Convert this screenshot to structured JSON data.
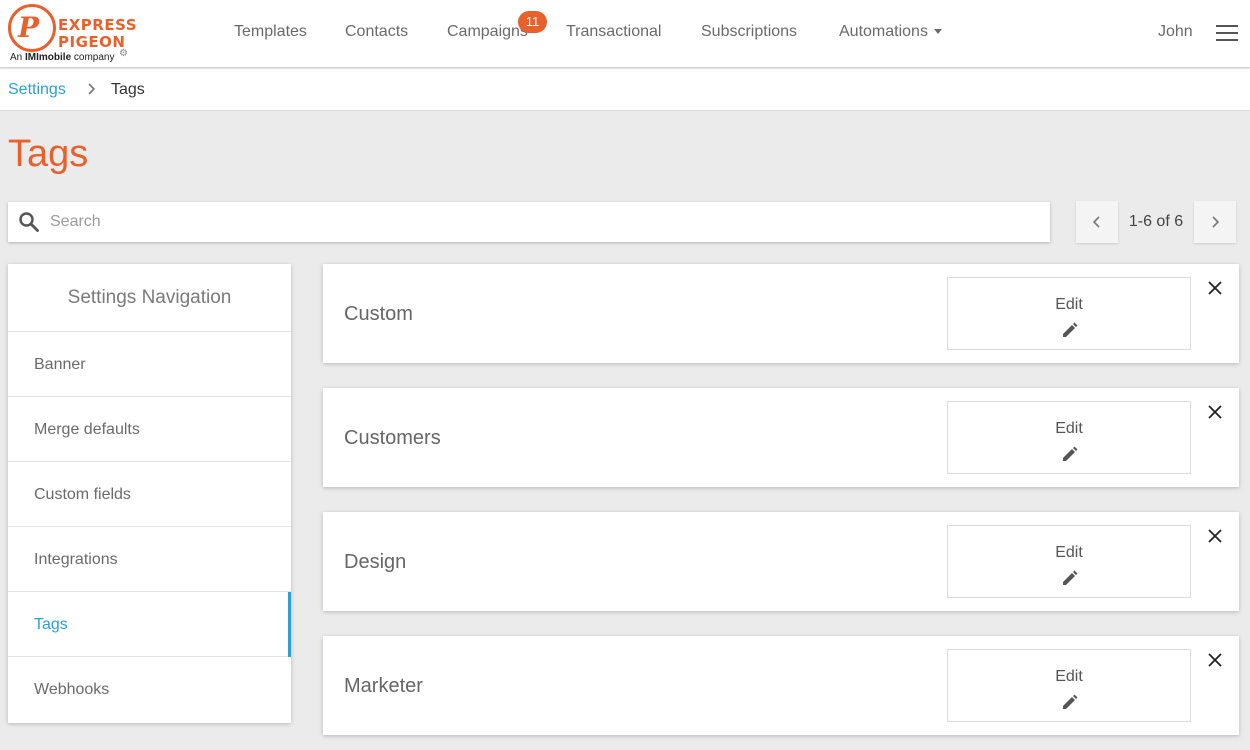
{
  "brand": {
    "line1": "EXPRESS",
    "line2": "PIGEON",
    "sub_prefix": "An ",
    "sub_bold": "IMImobile",
    "sub_suffix": " company",
    "accent": "#e8612c"
  },
  "nav": {
    "items": [
      {
        "label": "Templates"
      },
      {
        "label": "Contacts"
      },
      {
        "label": "Campaigns",
        "badge": "11"
      },
      {
        "label": "Transactional"
      },
      {
        "label": "Subscriptions"
      },
      {
        "label": "Automations"
      }
    ],
    "user": "John"
  },
  "breadcrumb": {
    "parent": "Settings",
    "separator": ">",
    "current": "Tags"
  },
  "page": {
    "title": "Tags"
  },
  "search": {
    "placeholder": "Search",
    "value": ""
  },
  "pager": {
    "label": "1-6 of 6"
  },
  "settings_nav": {
    "title": "Settings Navigation",
    "items": [
      {
        "label": "Banner"
      },
      {
        "label": "Merge defaults"
      },
      {
        "label": "Custom fields"
      },
      {
        "label": "Integrations"
      },
      {
        "label": "Tags",
        "active": true
      },
      {
        "label": "Webhooks"
      }
    ]
  },
  "tags": [
    {
      "name": "Custom",
      "edit_label": "Edit"
    },
    {
      "name": "Customers",
      "edit_label": "Edit"
    },
    {
      "name": "Design",
      "edit_label": "Edit"
    },
    {
      "name": "Marketer",
      "edit_label": "Edit"
    }
  ],
  "colors": {
    "link": "#2b9fd9",
    "title": "#e8612c"
  }
}
